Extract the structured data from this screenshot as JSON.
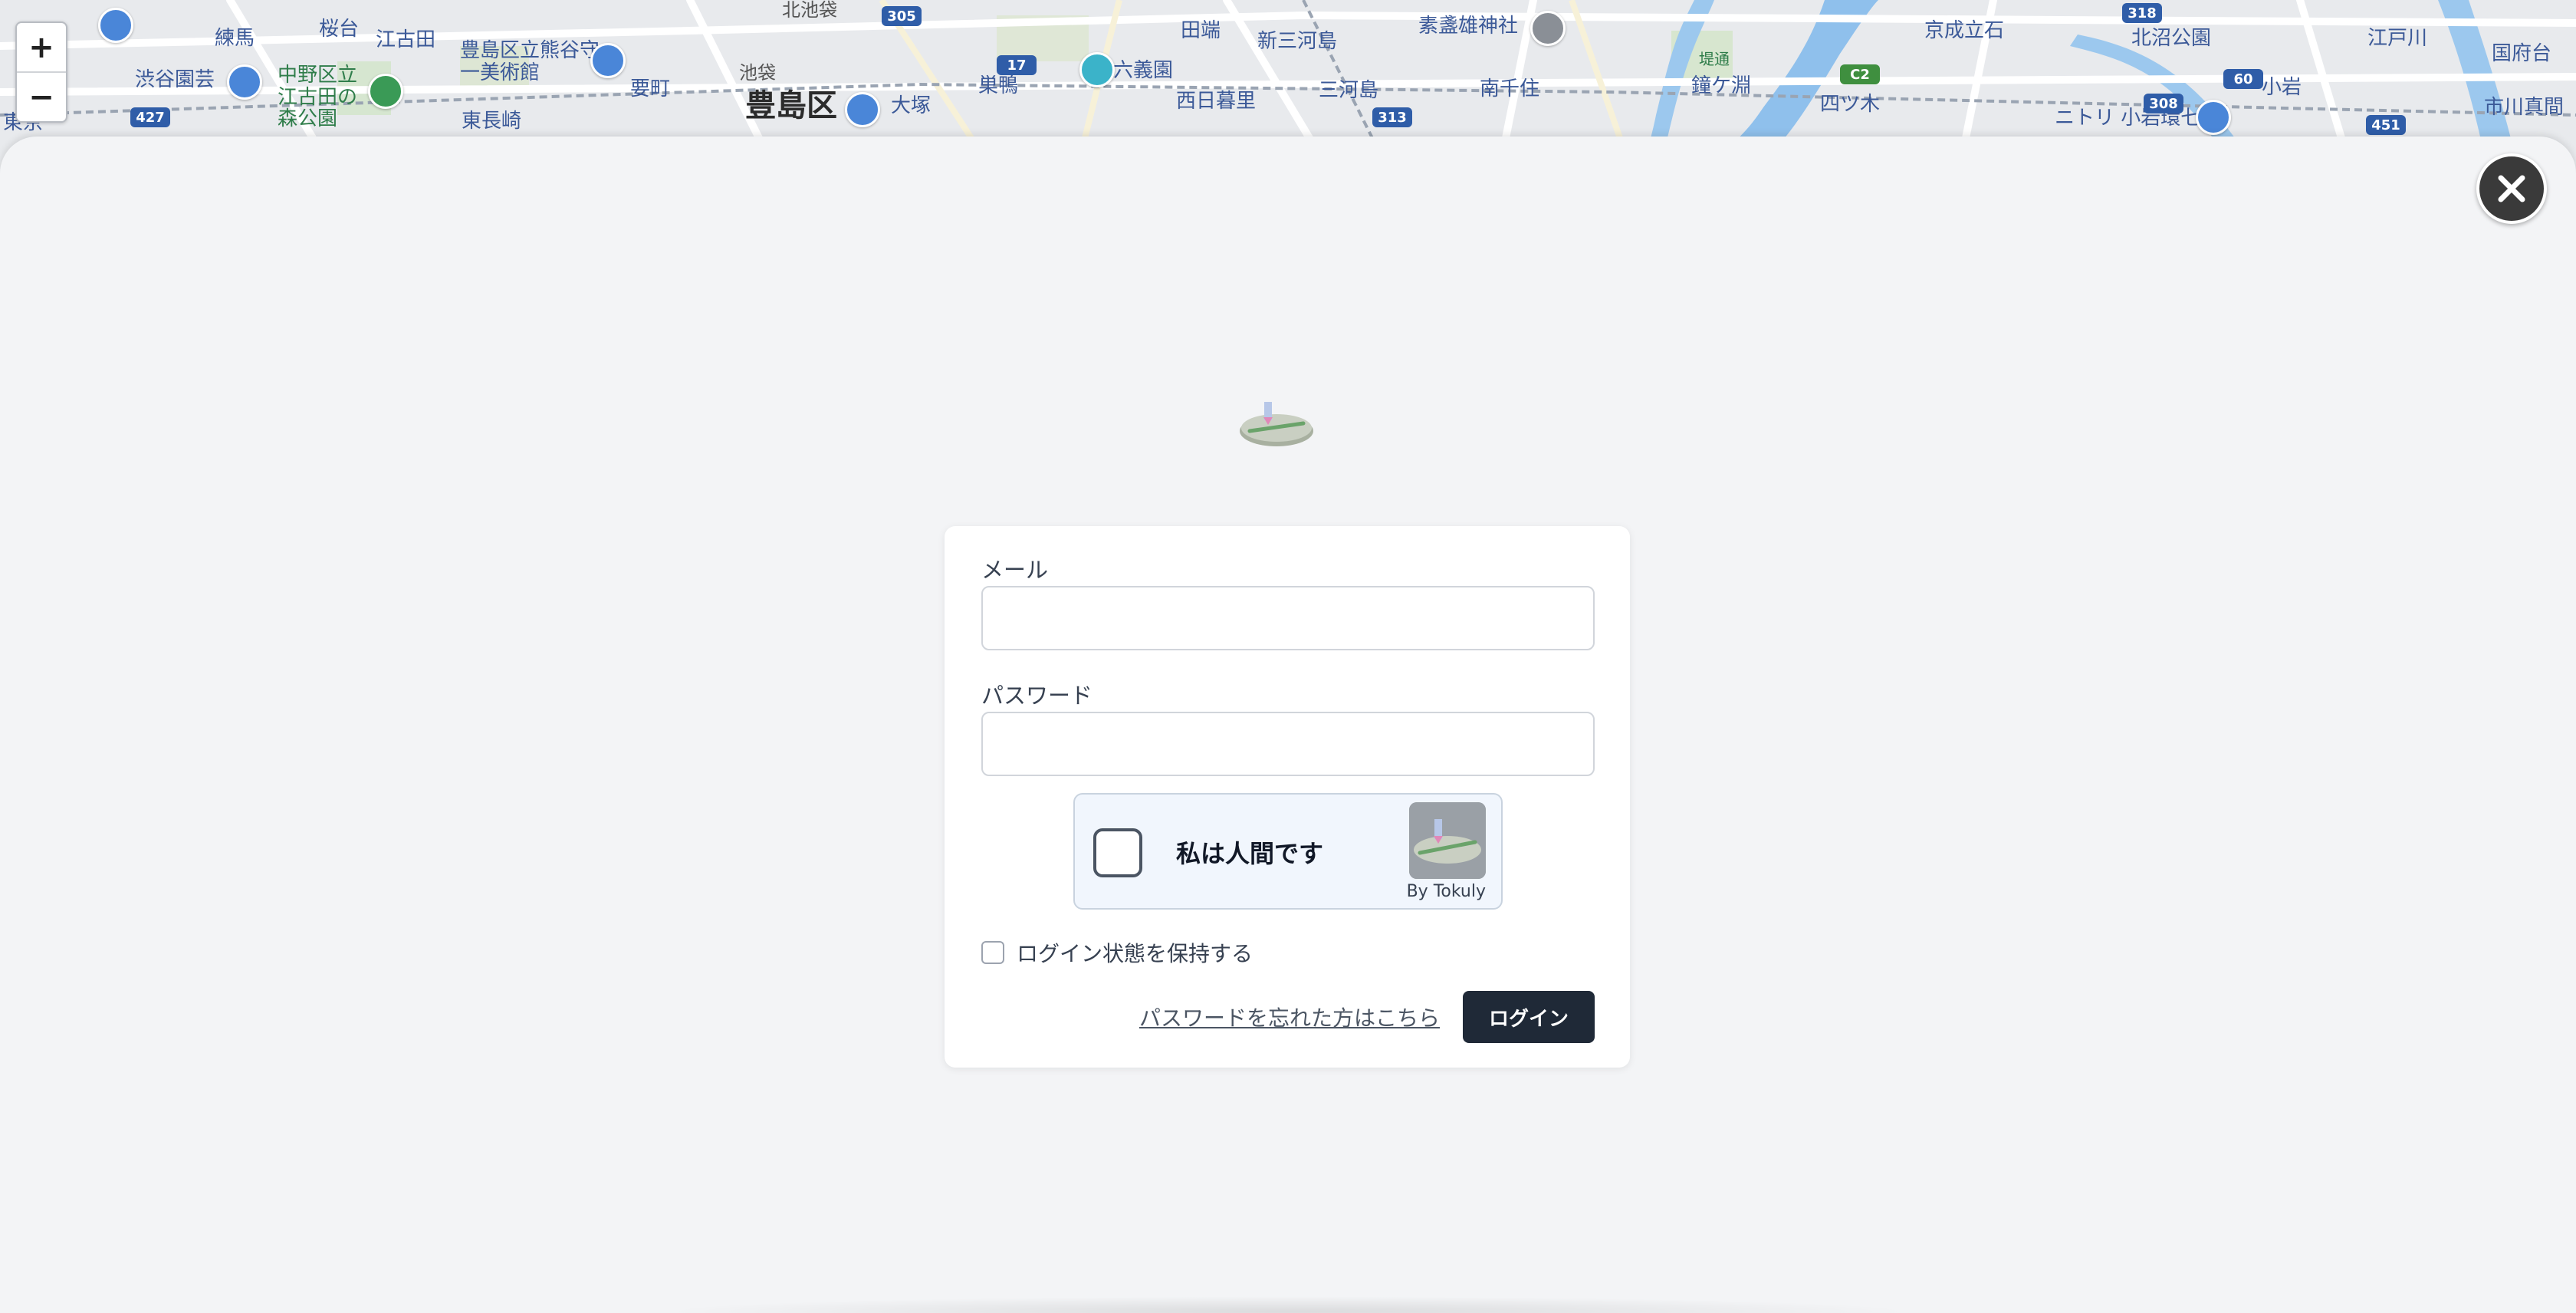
{
  "map": {
    "zoom_in_label": "+",
    "zoom_out_label": "−",
    "labels": [
      {
        "text": "北池袋",
        "style": "gray"
      },
      {
        "text": "305",
        "style": "shield"
      },
      {
        "text": "318",
        "style": "shield"
      },
      {
        "text": "練馬",
        "style": "blue"
      },
      {
        "text": "桜台",
        "style": "blue"
      },
      {
        "text": "江古田",
        "style": "blue"
      },
      {
        "text": "豊島区立熊谷守一美術館",
        "style": "blue"
      },
      {
        "text": "田端",
        "style": "blue"
      },
      {
        "text": "新三河島",
        "style": "blue"
      },
      {
        "text": "素盞雄神社",
        "style": "blue"
      },
      {
        "text": "京成立石",
        "style": "blue"
      },
      {
        "text": "北沼公園",
        "style": "blue"
      },
      {
        "text": "江戸川",
        "style": "blue"
      },
      {
        "text": "国府台",
        "style": "blue"
      },
      {
        "text": "渋谷園芸",
        "style": "blue"
      },
      {
        "text": "中野区立江古田の森公園",
        "style": "green"
      },
      {
        "text": "要町",
        "style": "blue"
      },
      {
        "text": "池袋",
        "style": "gray"
      },
      {
        "text": "豊島区",
        "style": "dark"
      },
      {
        "text": "大塚",
        "style": "blue"
      },
      {
        "text": "巣鴨",
        "style": "blue"
      },
      {
        "text": "六義園",
        "style": "blue"
      },
      {
        "text": "西日暮里",
        "style": "blue"
      },
      {
        "text": "三河島",
        "style": "blue"
      },
      {
        "text": "南千住",
        "style": "blue"
      },
      {
        "text": "堤通",
        "style": "green"
      },
      {
        "text": "鐘ケ淵",
        "style": "blue"
      },
      {
        "text": "四ツ木",
        "style": "blue"
      },
      {
        "text": "ニトリ 小岩環七店",
        "style": "blue"
      },
      {
        "text": "小岩",
        "style": "blue"
      },
      {
        "text": "市川真間",
        "style": "blue"
      },
      {
        "text": "東長崎",
        "style": "blue"
      },
      {
        "text": "東京",
        "style": "blue"
      },
      {
        "text": "427",
        "style": "shield"
      },
      {
        "text": "17",
        "style": "shield"
      },
      {
        "text": "313",
        "style": "shield"
      },
      {
        "text": "308",
        "style": "shield"
      },
      {
        "text": "451",
        "style": "shield"
      },
      {
        "text": "60",
        "style": "shield"
      },
      {
        "text": "C2",
        "style": "shield-green"
      }
    ]
  },
  "modal": {
    "close_label": "×"
  },
  "login": {
    "email_label": "メール",
    "email_value": "",
    "password_label": "パスワード",
    "password_value": "",
    "captcha_text": "私は人間です",
    "captcha_by": "By Tokuly",
    "remember_label": "ログイン状態を保持する",
    "remember_checked": false,
    "forgot_link": "パスワードを忘れた方はこちら",
    "login_button": "ログイン"
  },
  "colors": {
    "sheet_bg": "#f3f4f6",
    "card_bg": "#ffffff",
    "primary_button": "#1f2937",
    "captcha_bg": "#f1f6fd",
    "map_road": "#ffffff",
    "map_river": "#7fb6e8"
  }
}
